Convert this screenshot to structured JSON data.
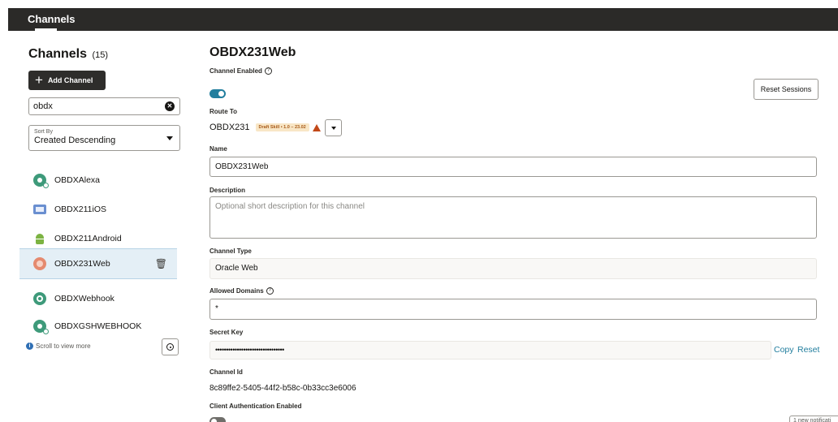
{
  "header": {
    "title": "Channels"
  },
  "sidebar": {
    "heading": "Channels",
    "count": "(15)",
    "add_button": "Add Channel",
    "search": {
      "value": "obdx"
    },
    "sort": {
      "label": "Sort By",
      "value": "Created Descending"
    },
    "items": [
      {
        "label": "OBDXAlexa",
        "icon": "alexa-icon"
      },
      {
        "label": "OBDX211iOS",
        "icon": "ios-icon"
      },
      {
        "label": "OBDX211Android",
        "icon": "android-icon"
      },
      {
        "label": "OBDX231Web",
        "icon": "web-icon",
        "selected": true
      },
      {
        "label": "OBDXWebhook",
        "icon": "webhook-icon"
      },
      {
        "label": "OBDXGSHWEBHOOK",
        "icon": "alexa-icon"
      }
    ],
    "scroll_hint": "Scroll to view more"
  },
  "detail": {
    "title": "OBDX231Web",
    "channel_enabled_label": "Channel Enabled",
    "reset_sessions": "Reset Sessions",
    "route_to_label": "Route To",
    "route_to_value": "OBDX231",
    "route_badge": "Draft Skill • 1.0 – 23.02",
    "name_label": "Name",
    "name_value": "OBDX231Web",
    "description_label": "Description",
    "description_placeholder": "Optional short description for this channel",
    "channel_type_label": "Channel Type",
    "channel_type_value": "Oracle Web",
    "allowed_domains_label": "Allowed Domains",
    "allowed_domains_value": "*",
    "secret_key_label": "Secret Key",
    "secret_key_value": "••••••••••••••••••••••••••••••••",
    "copy_link": "Copy",
    "reset_link": "Reset",
    "channel_id_label": "Channel Id",
    "channel_id_value": "8c89ffe2-5405-44f2-b58c-0b33cc3e6006",
    "client_auth_label": "Client Authentication Enabled"
  },
  "notification": "1 new notificati",
  "colors": {
    "header_bg": "#2b2a28",
    "accent": "#227e9e",
    "selected_bg": "#e4eff6"
  }
}
